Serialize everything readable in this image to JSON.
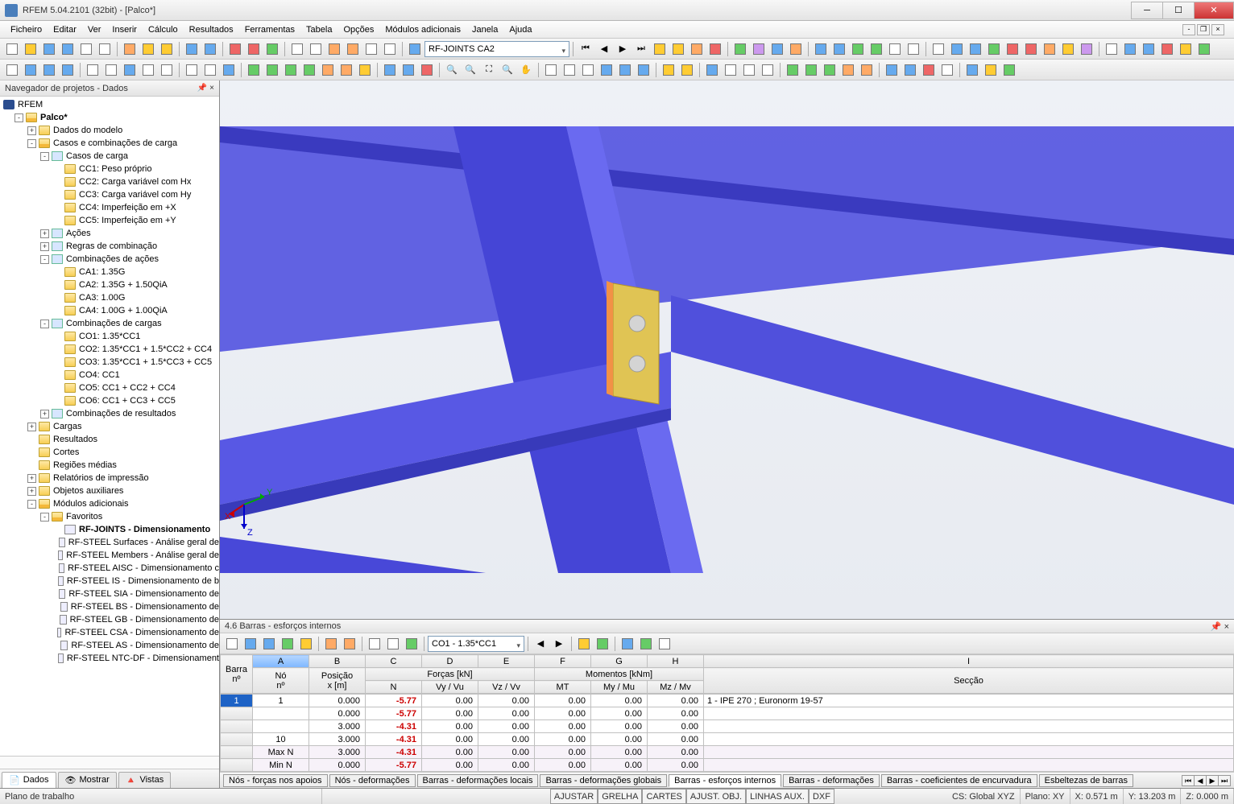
{
  "window": {
    "title": "RFEM 5.04.2101 (32bit) - [Palco*]"
  },
  "menu": [
    "Ficheiro",
    "Editar",
    "Ver",
    "Inserir",
    "Cálculo",
    "Resultados",
    "Ferramentas",
    "Tabela",
    "Opções",
    "Módulos adicionais",
    "Janela",
    "Ajuda"
  ],
  "combo_main": "RF-JOINTS CA2",
  "navigator": {
    "title": "Navegador de projetos - Dados",
    "root": "RFEM",
    "project": "Palco*",
    "nodes": {
      "dados_modelo": "Dados do modelo",
      "casos_comb": "Casos e combinações de carga",
      "casos_carga": "Casos de carga",
      "cc1": "CC1: Peso próprio",
      "cc2": "CC2: Carga variável com Hx",
      "cc3": "CC3: Carga variável com Hy",
      "cc4": "CC4: Imperfeição em +X",
      "cc5": "CC5: Imperfeição em +Y",
      "acoes": "Ações",
      "regras_comb": "Regras de combinação",
      "comb_acoes": "Combinações de ações",
      "ca1": "CA1: 1.35G",
      "ca2": "CA2: 1.35G + 1.50QiA",
      "ca3": "CA3: 1.00G",
      "ca4": "CA4: 1.00G + 1.00QiA",
      "comb_cargas": "Combinações de cargas",
      "co1": "CO1: 1.35*CC1",
      "co2": "CO2: 1.35*CC1 + 1.5*CC2 + CC4",
      "co3": "CO3: 1.35*CC1 + 1.5*CC3 + CC5",
      "co4": "CO4: CC1",
      "co5": "CO5: CC1 + CC2 + CC4",
      "co6": "CO6: CC1 + CC3 + CC5",
      "comb_result": "Combinações de resultados",
      "cargas": "Cargas",
      "resultados": "Resultados",
      "cortes": "Cortes",
      "regioes": "Regiões médias",
      "relatorios": "Relatórios de impressão",
      "obj_aux": "Objetos auxiliares",
      "mod_adic": "Módulos adicionais",
      "favoritos": "Favoritos",
      "rfjoints": "RF-JOINTS - Dimensionamento",
      "rfsteel_surf": "RF-STEEL Surfaces - Análise geral de",
      "rfsteel_mem": "RF-STEEL Members - Análise geral de",
      "rfsteel_aisc": "RF-STEEL AISC - Dimensionamento c",
      "rfsteel_is": "RF-STEEL IS - Dimensionamento de b",
      "rfsteel_sia": "RF-STEEL SIA - Dimensionamento de",
      "rfsteel_bs": "RF-STEEL BS - Dimensionamento de",
      "rfsteel_gb": "RF-STEEL GB - Dimensionamento de",
      "rfsteel_csa": "RF-STEEL CSA - Dimensionamento de",
      "rfsteel_as": "RF-STEEL AS - Dimensionamento de",
      "rfsteel_ntc": "RF-STEEL NTC-DF - Dimensionament"
    },
    "tabs": {
      "dados": "Dados",
      "mostrar": "Mostrar",
      "vistas": "Vistas"
    }
  },
  "table": {
    "title": "4.6 Barras - esforços internos",
    "combo": "CO1 - 1.35*CC1",
    "col_letters": [
      "A",
      "B",
      "C",
      "D",
      "E",
      "F",
      "G",
      "H",
      "I"
    ],
    "hdr_group_forcas": "Forças [kN]",
    "hdr_group_momentos": "Momentos [kNm]",
    "hdrs": {
      "barra": "Barra",
      "barra2": "nº",
      "no": "Nó",
      "no2": "nº",
      "pos": "Posição",
      "pos2": "x [m]",
      "N": "N",
      "Vy": "Vy / Vu",
      "Vz": "Vz / Vv",
      "MT": "MT",
      "My": "My / Mu",
      "Mz": "Mz / Mv",
      "seccao": "Secção"
    },
    "rows": [
      {
        "barra": "1",
        "no": "1",
        "x": "0.000",
        "N": "-5.77",
        "Vy": "0.00",
        "Vz": "0.00",
        "MT": "0.00",
        "My": "0.00",
        "Mz": "0.00",
        "sec": "1 - IPE 270 ; Euronorm 19-57"
      },
      {
        "barra": "",
        "no": "",
        "x": "0.000",
        "N": "-5.77",
        "Vy": "0.00",
        "Vz": "0.00",
        "MT": "0.00",
        "My": "0.00",
        "Mz": "0.00",
        "sec": ""
      },
      {
        "barra": "",
        "no": "",
        "x": "3.000",
        "N": "-4.31",
        "Vy": "0.00",
        "Vz": "0.00",
        "MT": "0.00",
        "My": "0.00",
        "Mz": "0.00",
        "sec": ""
      },
      {
        "barra": "",
        "no": "10",
        "x": "3.000",
        "N": "-4.31",
        "Vy": "0.00",
        "Vz": "0.00",
        "MT": "0.00",
        "My": "0.00",
        "Mz": "0.00",
        "sec": ""
      },
      {
        "barra": "",
        "no": "Max N",
        "x": "3.000",
        "N": "-4.31",
        "Vy": "0.00",
        "Vz": "0.00",
        "MT": "0.00",
        "My": "0.00",
        "Mz": "0.00",
        "sec": "",
        "alt": true
      },
      {
        "barra": "",
        "no": "Min N",
        "x": "0.000",
        "N": "-5.77",
        "Vy": "0.00",
        "Vz": "0.00",
        "MT": "0.00",
        "My": "0.00",
        "Mz": "0.00",
        "sec": "",
        "alt": true
      }
    ],
    "tabs": [
      "Nós - forças nos apoios",
      "Nós - deformações",
      "Barras - deformações locais",
      "Barras - deformações globais",
      "Barras - esforços internos",
      "Barras - deformações",
      "Barras - coeficientes de encurvadura",
      "Esbeltezas de barras"
    ],
    "active_tab": 4
  },
  "status": {
    "left": "Plano de trabalho",
    "btns": [
      "AJUSTAR",
      "GRELHA",
      "CARTES",
      "AJUST. OBJ.",
      "LINHAS AUX.",
      "DXF"
    ],
    "cs": "CS: Global XYZ",
    "plano": "Plano: XY",
    "x": "X: 0.571 m",
    "y": "Y: 13.203 m",
    "z": "Z: 0.000 m"
  }
}
